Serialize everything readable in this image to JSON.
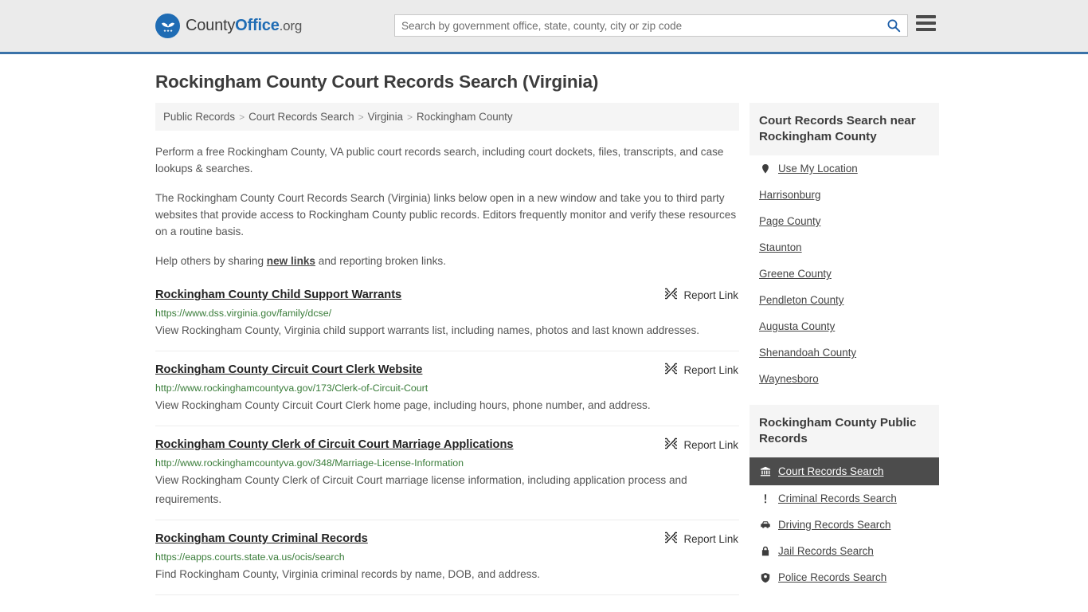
{
  "header": {
    "brand": {
      "pre": "County",
      "bold": "Office",
      "tld": ".org"
    },
    "search": {
      "placeholder": "Search by government office, state, county, city or zip code",
      "value": ""
    },
    "icons": {
      "search": "search-icon",
      "menu": "hamburger-menu-icon"
    },
    "accent_color": "#3a72a8",
    "background_color": "#ebebeb"
  },
  "page": {
    "title": "Rockingham County Court Records Search (Virginia)"
  },
  "breadcrumb": {
    "items": [
      {
        "label": "Public Records"
      },
      {
        "label": "Court Records Search"
      },
      {
        "label": "Virginia"
      },
      {
        "label": "Rockingham County"
      }
    ],
    "separator": ">"
  },
  "intro": {
    "p1": "Perform a free Rockingham County, VA public court records search, including court dockets, files, transcripts, and case lookups & searches.",
    "p2": "The Rockingham County Court Records Search (Virginia) links below open in a new window and take you to third party websites that provide access to Rockingham County public records. Editors frequently monitor and verify these resources on a routine basis.",
    "p3_before": "Help others by sharing ",
    "p3_link": "new links",
    "p3_after": " and reporting broken links."
  },
  "results": {
    "report_label": "Report Link",
    "report_icon": "broken-link-icon",
    "url_color": "#3a7d3a",
    "items": [
      {
        "title": "Rockingham County Child Support Warrants",
        "url": "https://www.dss.virginia.gov/family/dcse/",
        "description": "View Rockingham County, Virginia child support warrants list, including names, photos and last known addresses."
      },
      {
        "title": "Rockingham County Circuit Court Clerk Website",
        "url": "http://www.rockinghamcountyva.gov/173/Clerk-of-Circuit-Court",
        "description": "View Rockingham County Circuit Court Clerk home page, including hours, phone number, and address."
      },
      {
        "title": "Rockingham County Clerk of Circuit Court Marriage Applications",
        "url": "http://www.rockinghamcountyva.gov/348/Marriage-License-Information",
        "description": "View Rockingham County Clerk of Circuit Court marriage license information, including application process and requirements."
      },
      {
        "title": "Rockingham County Criminal Records",
        "url": "https://eapps.courts.state.va.us/ocis/search",
        "description": "Find Rockingham County, Virginia criminal records by name, DOB, and address."
      }
    ]
  },
  "sidebar": {
    "nearby": {
      "heading": "Court Records Search near Rockingham County",
      "items": [
        {
          "label": "Use My Location",
          "icon": "map-pin-icon"
        },
        {
          "label": "Harrisonburg",
          "icon": ""
        },
        {
          "label": "Page County",
          "icon": ""
        },
        {
          "label": "Staunton",
          "icon": ""
        },
        {
          "label": "Greene County",
          "icon": ""
        },
        {
          "label": "Pendleton County",
          "icon": ""
        },
        {
          "label": "Augusta County",
          "icon": ""
        },
        {
          "label": "Shenandoah County",
          "icon": ""
        },
        {
          "label": "Waynesboro",
          "icon": ""
        }
      ]
    },
    "public_records": {
      "heading": "Rockingham County Public Records",
      "active_background": "#4c4c4c",
      "items": [
        {
          "label": "Court Records Search",
          "icon": "courthouse-icon",
          "active": true
        },
        {
          "label": "Criminal Records Search",
          "icon": "exclamation-icon",
          "active": false
        },
        {
          "label": "Driving Records Search",
          "icon": "car-icon",
          "active": false
        },
        {
          "label": "Jail Records Search",
          "icon": "padlock-icon",
          "active": false
        },
        {
          "label": "Police Records Search",
          "icon": "police-badge-icon",
          "active": false
        }
      ]
    }
  }
}
